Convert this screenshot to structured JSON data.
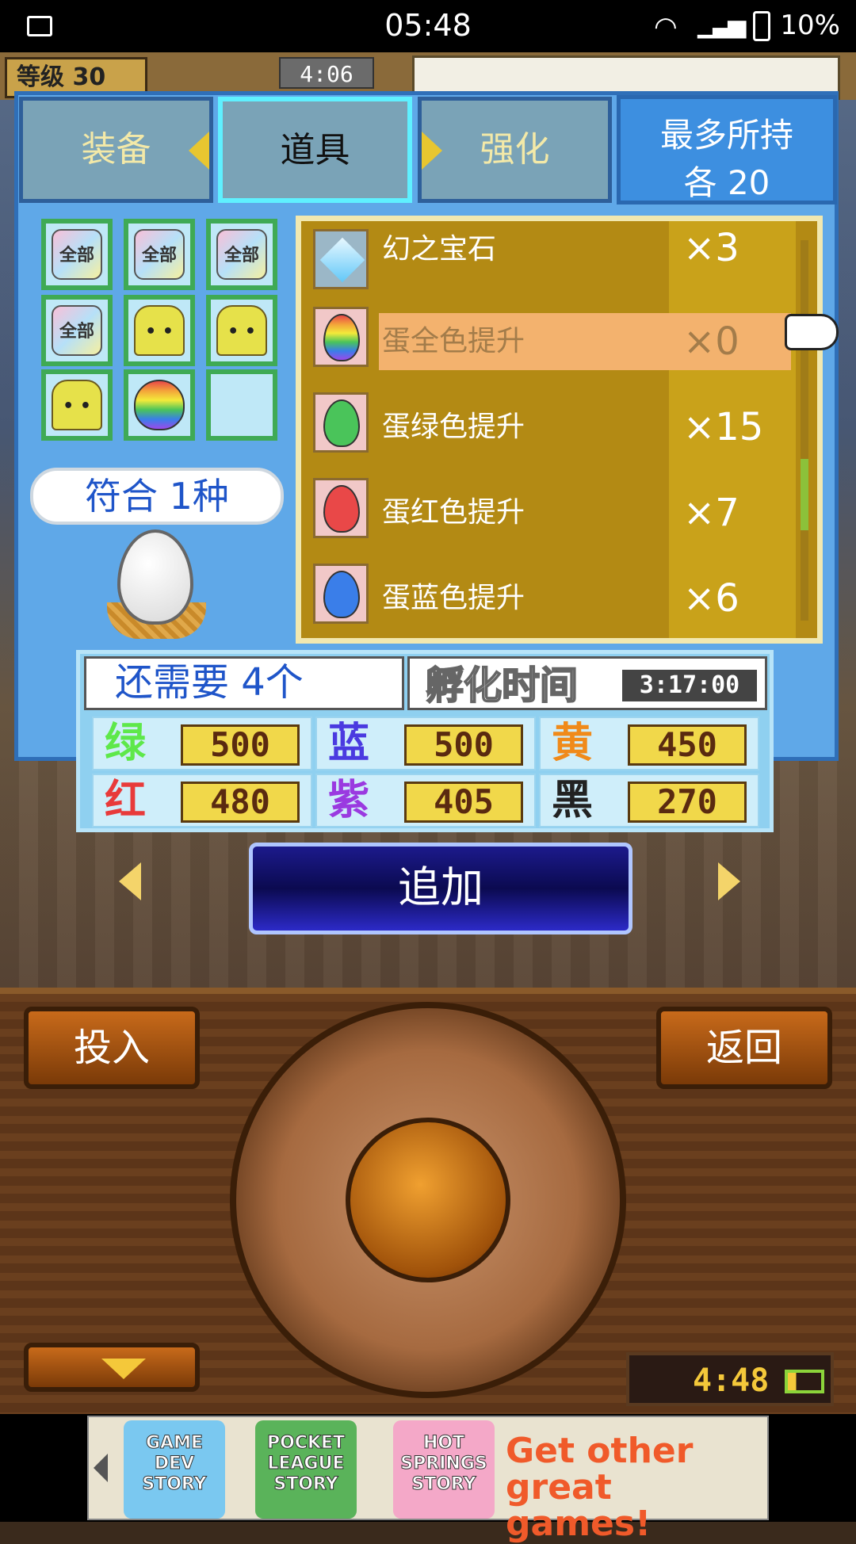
{
  "status_bar": {
    "time": "05:48",
    "battery": "10%"
  },
  "hud": {
    "level_label": "等级 30",
    "timer": "4:06"
  },
  "tabs": {
    "equip": "装备",
    "items": "道具",
    "upgrade": "强化"
  },
  "max_hold": {
    "line1": "最多所持",
    "line2": "各 20"
  },
  "inventory": {
    "slots": [
      {
        "icon": "all-icon",
        "label": "全部"
      },
      {
        "icon": "all-icon",
        "label": "全部"
      },
      {
        "icon": "all-icon",
        "label": "全部"
      },
      {
        "icon": "all-icon",
        "label": "全部"
      },
      {
        "icon": "chick-icon",
        "label": ""
      },
      {
        "icon": "chick-icon",
        "label": ""
      },
      {
        "icon": "chick-icon",
        "label": ""
      },
      {
        "icon": "rainbow-egg-icon",
        "label": ""
      },
      {
        "icon": "empty",
        "label": ""
      }
    ],
    "match_text": "符合 1种"
  },
  "item_list": [
    {
      "name": "幻之宝石",
      "count": "×3",
      "icon": "gem-icon",
      "color": "#62c8f8"
    },
    {
      "name": "蛋全色提升",
      "count": "×0",
      "icon": "rainbow-egg-icon",
      "color": "rainbow",
      "selected": true
    },
    {
      "name": "蛋绿色提升",
      "count": "×15",
      "icon": "green-egg-icon",
      "color": "#4ac45a"
    },
    {
      "name": "蛋红色提升",
      "count": "×7",
      "icon": "red-egg-icon",
      "color": "#e94848"
    },
    {
      "name": "蛋蓝色提升",
      "count": "×6",
      "icon": "blue-egg-icon",
      "color": "#3a7ee9"
    }
  ],
  "need": {
    "text": "还需要 4个",
    "hatch_label": "孵化时间",
    "hatch_time": "3:17:00"
  },
  "colors": [
    {
      "name": "绿",
      "value": "500",
      "color": "#5ee84a"
    },
    {
      "name": "蓝",
      "value": "500",
      "color": "#4a3ae0"
    },
    {
      "name": "黄",
      "value": "450",
      "color": "#f08a1a"
    },
    {
      "name": "红",
      "value": "480",
      "color": "#e83a3a"
    },
    {
      "name": "紫",
      "value": "405",
      "color": "#9a3ae0"
    },
    {
      "name": "黑",
      "value": "270",
      "color": "#222222"
    }
  ],
  "add_button": "追加",
  "controls": {
    "drop": "投入",
    "back": "返回",
    "clock": "4:48"
  },
  "ad": {
    "games": [
      "GAME DEV STORY",
      "POCKET LEAGUE STORY",
      "HOT SPRINGS STORY"
    ],
    "cta": "Get other great games!"
  }
}
